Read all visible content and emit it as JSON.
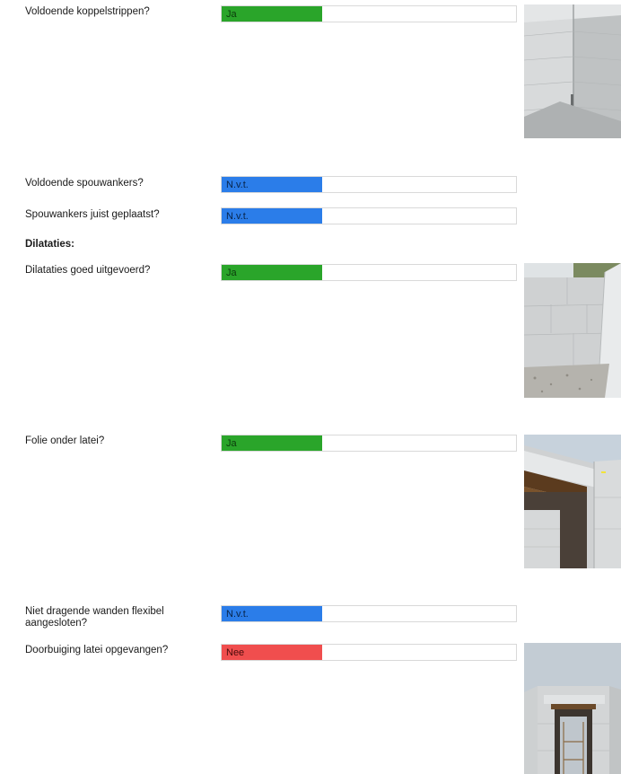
{
  "colors": {
    "ja": "#2aa52a",
    "nvt": "#2b7de9",
    "nee": "#f04e4e"
  },
  "items": [
    {
      "question": "Voldoende koppelstrippen?",
      "answer": "Ja",
      "photo": "concrete-corner-wall-photo"
    },
    {
      "question": "Voldoende spouwankers?",
      "answer": "N.v.t."
    },
    {
      "question": "Spouwankers juist geplaatst?",
      "answer": "N.v.t."
    },
    {
      "question": "Dilataties goed uitgevoerd?",
      "answer": "Ja",
      "photo": "concrete-block-wall-photo"
    },
    {
      "question": "Folie onder latei?",
      "answer": "Ja",
      "photo": "lintel-foil-photo"
    },
    {
      "question": "Niet dragende wanden flexibel aangesloten?",
      "answer": "N.v.t."
    },
    {
      "question": "Doorbuiging latei opgevangen?",
      "answer": "Nee",
      "photo": "doorway-lintel-photo"
    }
  ],
  "section": "Dilataties:"
}
